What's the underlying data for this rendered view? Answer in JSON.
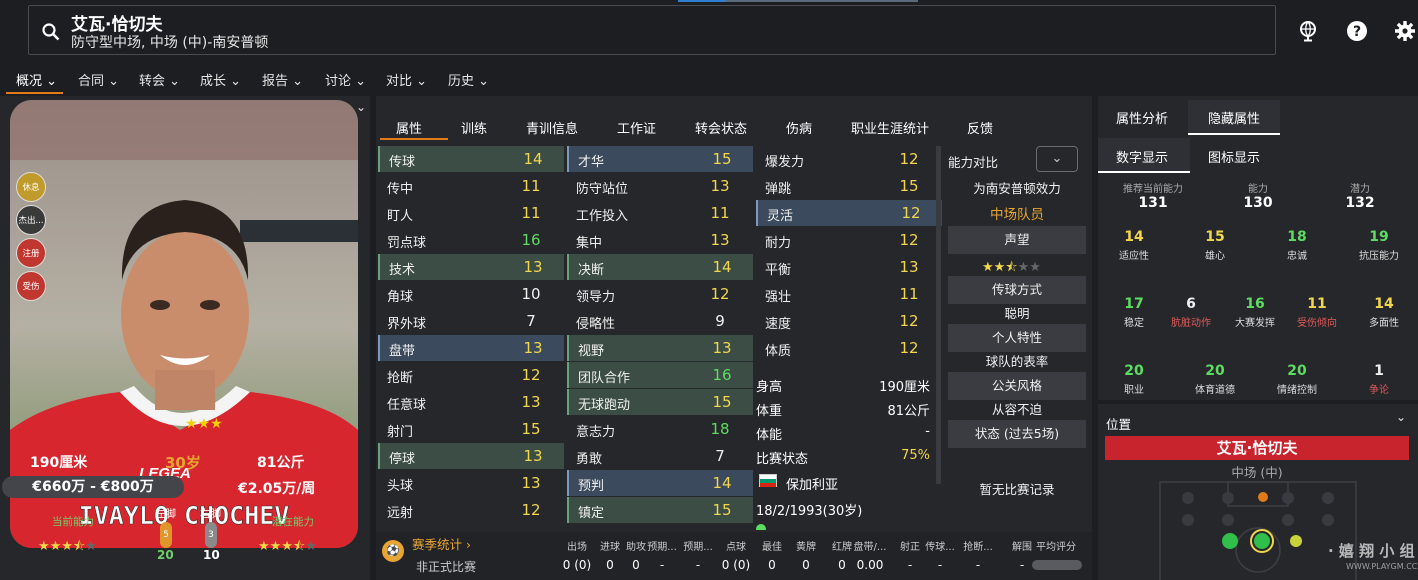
{
  "header": {
    "player_name": "艾瓦·恰切夫",
    "player_position": "防守型中场, 中场 (中)-南安普顿"
  },
  "menu": [
    {
      "label": "概况"
    },
    {
      "label": "合同"
    },
    {
      "label": "转会"
    },
    {
      "label": "成长"
    },
    {
      "label": "报告"
    },
    {
      "label": "讨论"
    },
    {
      "label": "对比"
    },
    {
      "label": "历史"
    }
  ],
  "left": {
    "shirt_text": "IVAYLO CHOCHEV",
    "shirt_brand": "LEGEA",
    "status_badges": [
      "休息",
      "杰出...",
      "注册",
      "受伤"
    ],
    "height": "190厘米",
    "age": "30岁",
    "weight": "81公斤",
    "value": "€660万 - €800万",
    "wage": "€2.05万/周",
    "current_ability_label": "当前能力",
    "potential_ability_label": "潜在能力",
    "left_foot_label": "左脚",
    "right_foot_label": "右脚",
    "left_foot_grade": "5",
    "right_foot_grade": "3",
    "left_foot_value": "20",
    "right_foot_value": "10",
    "current_stars": 3.5,
    "potential_stars": 3.5
  },
  "tabs": [
    "属性",
    "训练",
    "青训信息",
    "工作证",
    "转会状态",
    "伤病",
    "职业生涯统计",
    "反馈"
  ],
  "attributes": {
    "col1": [
      {
        "name": "传球",
        "value": "14",
        "c": "y",
        "hl": "g"
      },
      {
        "name": "传中",
        "value": "11",
        "c": "y"
      },
      {
        "name": "盯人",
        "value": "11",
        "c": "y"
      },
      {
        "name": "罚点球",
        "value": "16",
        "c": "g"
      },
      {
        "name": "技术",
        "value": "13",
        "c": "y",
        "hl": "g"
      },
      {
        "name": "角球",
        "value": "10",
        "c": "w"
      },
      {
        "name": "界外球",
        "value": "7",
        "c": "w"
      },
      {
        "name": "盘带",
        "value": "13",
        "c": "y",
        "hl": "b"
      },
      {
        "name": "抢断",
        "value": "12",
        "c": "y"
      },
      {
        "name": "任意球",
        "value": "13",
        "c": "y"
      },
      {
        "name": "射门",
        "value": "15",
        "c": "y"
      },
      {
        "name": "停球",
        "value": "13",
        "c": "y",
        "hl": "g"
      },
      {
        "name": "头球",
        "value": "13",
        "c": "y"
      },
      {
        "name": "远射",
        "value": "12",
        "c": "y"
      }
    ],
    "col2": [
      {
        "name": "才华",
        "value": "15",
        "c": "y",
        "hl": "b"
      },
      {
        "name": "防守站位",
        "value": "13",
        "c": "y"
      },
      {
        "name": "工作投入",
        "value": "11",
        "c": "y"
      },
      {
        "name": "集中",
        "value": "13",
        "c": "y"
      },
      {
        "name": "决断",
        "value": "14",
        "c": "y",
        "hl": "g"
      },
      {
        "name": "领导力",
        "value": "12",
        "c": "y"
      },
      {
        "name": "侵略性",
        "value": "9",
        "c": "w"
      },
      {
        "name": "视野",
        "value": "13",
        "c": "y",
        "hl": "g"
      },
      {
        "name": "团队合作",
        "value": "16",
        "c": "g",
        "hl": "g"
      },
      {
        "name": "无球跑动",
        "value": "15",
        "c": "y",
        "hl": "g"
      },
      {
        "name": "意志力",
        "value": "18",
        "c": "g"
      },
      {
        "name": "勇敢",
        "value": "7",
        "c": "w"
      },
      {
        "name": "预判",
        "value": "14",
        "c": "y",
        "hl": "b"
      },
      {
        "name": "镇定",
        "value": "15",
        "c": "y",
        "hl": "g"
      }
    ],
    "col3": [
      {
        "name": "爆发力",
        "value": "12",
        "c": "y"
      },
      {
        "name": "弹跳",
        "value": "15",
        "c": "y"
      },
      {
        "name": "灵活",
        "value": "12",
        "c": "y",
        "hl": "b"
      },
      {
        "name": "耐力",
        "value": "12",
        "c": "y"
      },
      {
        "name": "平衡",
        "value": "13",
        "c": "y"
      },
      {
        "name": "强壮",
        "value": "11",
        "c": "y"
      },
      {
        "name": "速度",
        "value": "12",
        "c": "y"
      },
      {
        "name": "体质",
        "value": "12",
        "c": "y"
      }
    ]
  },
  "info": [
    {
      "label": "身高",
      "value": "190厘米"
    },
    {
      "label": "体重",
      "value": "81公斤"
    },
    {
      "label": "体能",
      "value": "-"
    },
    {
      "label": "比赛状态",
      "value": "75%"
    }
  ],
  "nationality": "保加利亚",
  "birth": "18/2/1993(30岁)",
  "compare": {
    "label": "能力对比",
    "plays_for": "为南安普顿效力",
    "role": "中场队员",
    "reputation_btn": "声望",
    "reputation_stars": 2.5,
    "passing_btn": "传球方式",
    "passing_val": "聪明",
    "personality_btn": "个人特性",
    "personality_val": "球队的表率",
    "media_btn": "公关风格",
    "media_val": "从容不迫",
    "form_btn": "状态 (过去5场)",
    "form_val": "暂无比赛记录"
  },
  "season": {
    "title": "赛季统计",
    "headers": [
      "出场",
      "进球",
      "助攻",
      "预期...",
      "预期...",
      "点球",
      "最佳",
      "黄牌",
      "红牌",
      "盘带/...",
      "射正",
      "传球...",
      "抢断...",
      "解围",
      "平均评分"
    ],
    "row_label": "非正式比赛",
    "row": [
      "0 (0)",
      "0",
      "0",
      "-",
      "-",
      "0 (0)",
      "0",
      "0",
      "0",
      "0.00",
      "-",
      "-",
      "-",
      "-",
      "-"
    ]
  },
  "hidden": {
    "tabs": [
      "属性分析",
      "隐藏属性"
    ],
    "subtabs": [
      "数字显示",
      "图标显示"
    ],
    "top": [
      {
        "label": "推荐当前能力",
        "value": "131"
      },
      {
        "label": "能力",
        "value": "130"
      },
      {
        "label": "潜力",
        "value": "132"
      }
    ],
    "grid": [
      {
        "value": "14",
        "label": "适应性",
        "c": "y",
        "lc": "w"
      },
      {
        "value": "15",
        "label": "雄心",
        "c": "y",
        "lc": "w"
      },
      {
        "value": "18",
        "label": "忠诚",
        "c": "g",
        "lc": "w"
      },
      {
        "value": "19",
        "label": "抗压能力",
        "c": "g",
        "lc": "w"
      },
      {
        "value": "17",
        "label": "稳定",
        "c": "g",
        "lc": "w"
      },
      {
        "value": "6",
        "label": "肮脏动作",
        "c": "w",
        "lc": "r"
      },
      {
        "value": "16",
        "label": "大赛发挥",
        "c": "g",
        "lc": "w"
      },
      {
        "value": "11",
        "label": "受伤倾向",
        "c": "y",
        "lc": "r"
      },
      {
        "value": "14",
        "label": "多面性",
        "c": "y",
        "lc": "w"
      },
      {
        "value": "20",
        "label": "职业",
        "c": "g",
        "lc": "w"
      },
      {
        "value": "20",
        "label": "体育道德",
        "c": "g",
        "lc": "w"
      },
      {
        "value": "20",
        "label": "情绪控制",
        "c": "g",
        "lc": "w"
      },
      {
        "value": "1",
        "label": "争论",
        "c": "w",
        "lc": "r"
      }
    ]
  },
  "position": {
    "title": "位置",
    "name": "艾瓦·恰切夫",
    "role": "中场 (中)"
  },
  "watermark": "· 嬉 翔 小 组",
  "watermark_url": "WWW.PLAYGM.CC",
  "colors": {
    "accent": "#e07a1a",
    "yellow": "#f2d64b",
    "green": "#5ddc62",
    "red_bar": "#c8242d"
  }
}
